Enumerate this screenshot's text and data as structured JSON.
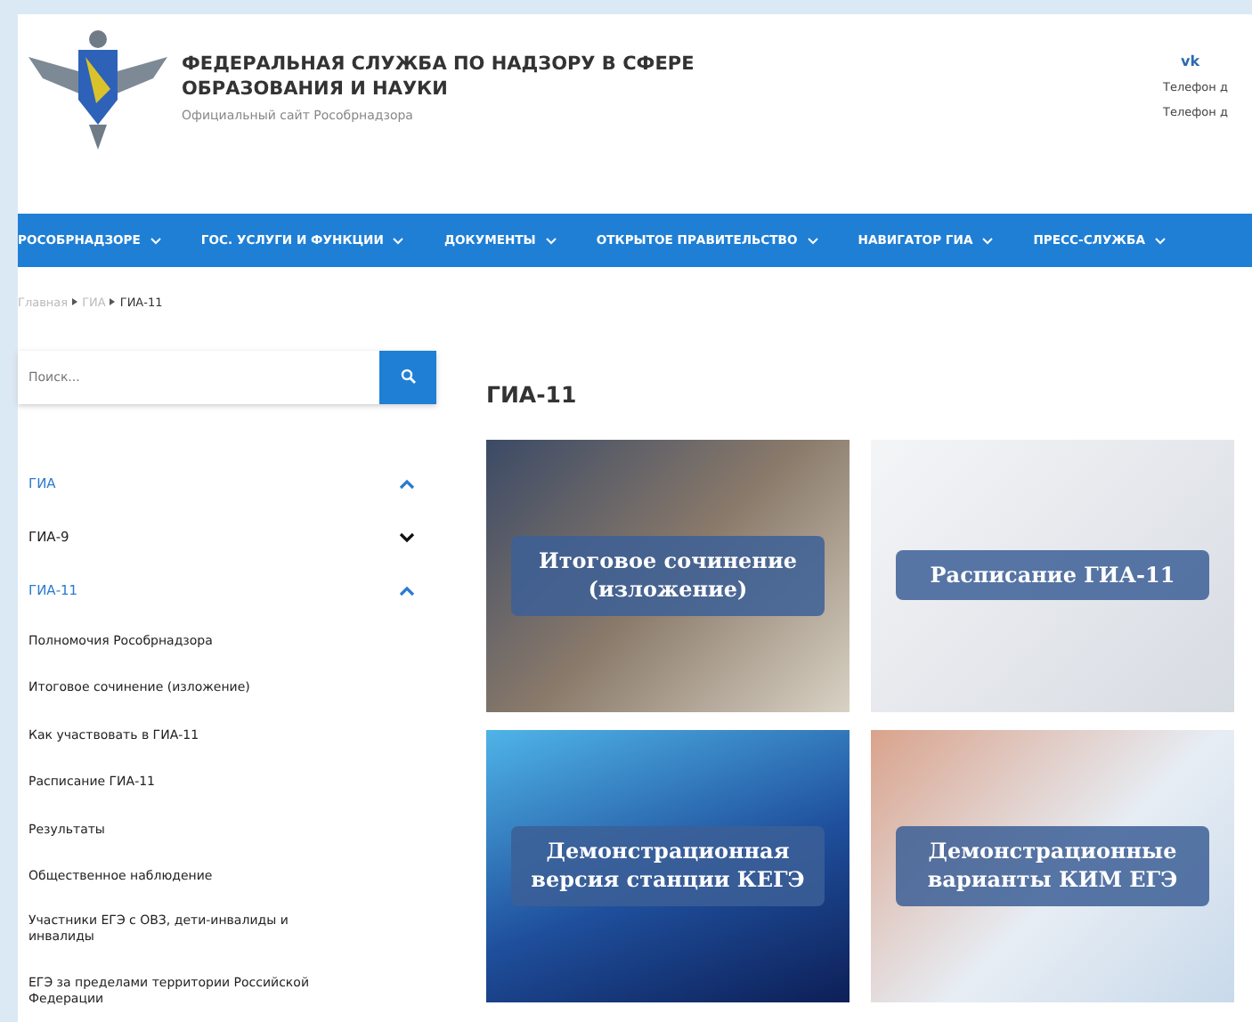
{
  "header": {
    "title_line_1": "ФЕДЕРАЛЬНАЯ СЛУЖБА ПО НАДЗОРУ В СФЕРЕ",
    "title_line_2": "ОБРАЗОВАНИЯ И НАУКИ",
    "subtitle": "Официальный сайт Рособрнадзора",
    "social": "vk",
    "phones": [
      "Телефон д",
      "Телефон д"
    ]
  },
  "nav": [
    {
      "label": "РОСОБРНАДЗОРЕ"
    },
    {
      "label": "ГОС. УСЛУГИ И ФУНКЦИИ"
    },
    {
      "label": "ДОКУМЕНТЫ"
    },
    {
      "label": "ОТКРЫТОЕ ПРАВИТЕЛЬСТВО"
    },
    {
      "label": "НАВИГАТОР ГИА"
    },
    {
      "label": "ПРЕСС-СЛУЖБА"
    }
  ],
  "breadcrumbs": [
    "Главная",
    "ГИА",
    "ГИА-11"
  ],
  "search": {
    "placeholder": "Поиск..."
  },
  "sidebar": {
    "items": [
      {
        "label": "ГИА",
        "expanded": true,
        "children": [
          {
            "label": "ГИА-9",
            "expanded": false
          },
          {
            "label": "ГИА-11",
            "expanded": true,
            "children": [
              {
                "label": "Полномочия Рособрнадзора"
              },
              {
                "label": "Итоговое сочинение (изложение)"
              },
              {
                "label": "Как участвовать в ГИА-11"
              },
              {
                "label": "Расписание ГИА-11"
              },
              {
                "label": "Результаты"
              },
              {
                "label": "Общественное наблюдение"
              },
              {
                "label": "Участники ЕГЭ с ОВЗ, дети-инвалиды и инвалиды"
              },
              {
                "label": "ЕГЭ за пределами территории Российской Федерации"
              }
            ]
          }
        ]
      }
    ]
  },
  "main": {
    "heading": "ГИА-11",
    "cards": [
      {
        "label": "Итоговое сочинение (изложение)",
        "kind": "writing"
      },
      {
        "label": "Расписание ГИА-11",
        "kind": "calendar"
      },
      {
        "label": "Демонстрационная версия станции КЕГЭ",
        "kind": "tech"
      },
      {
        "label": "Демонстрационные варианты КИМ ЕГЭ",
        "kind": "form"
      }
    ]
  }
}
